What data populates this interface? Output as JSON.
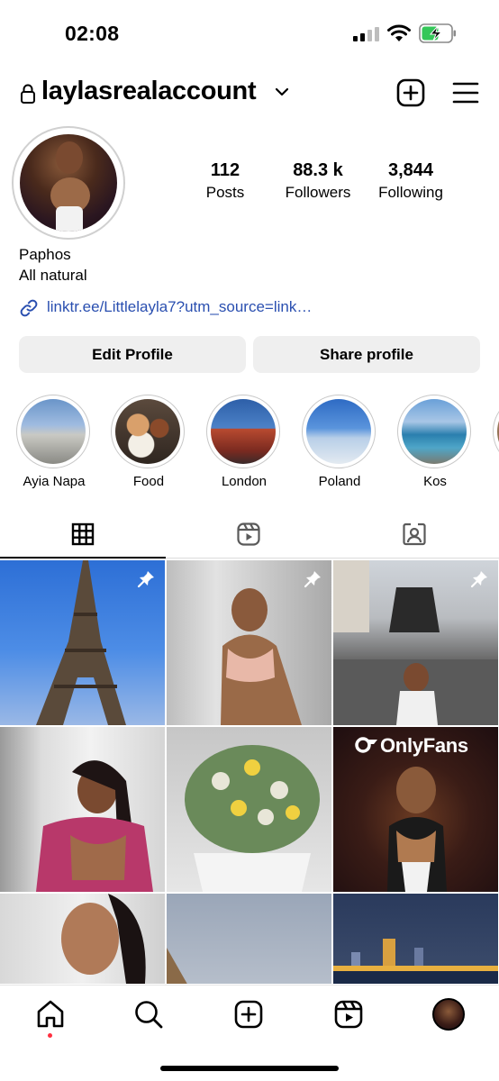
{
  "status_bar": {
    "time": "02:08"
  },
  "header": {
    "username": "laylasrealaccount"
  },
  "profile": {
    "stats": [
      {
        "value": "112",
        "label": "Posts"
      },
      {
        "value": "88.3 k",
        "label": "Followers"
      },
      {
        "value": "3,844",
        "label": "Following"
      }
    ],
    "bio": [
      "Paphos",
      "All natural"
    ],
    "link": "linktr.ee/Littlelayla7?utm_source=link…",
    "buttons": {
      "edit": "Edit Profile",
      "share": "Share profile"
    }
  },
  "highlights": [
    {
      "label": "Ayia Napa"
    },
    {
      "label": "Food"
    },
    {
      "label": "London"
    },
    {
      "label": "Poland"
    },
    {
      "label": "Kos"
    }
  ],
  "grid": {
    "pinned_count": 3,
    "promo_text": "OnlyFans"
  },
  "colors": {
    "link": "#2a4fb0",
    "button_bg": "#efefef",
    "notification_dot": "#ff3040"
  }
}
